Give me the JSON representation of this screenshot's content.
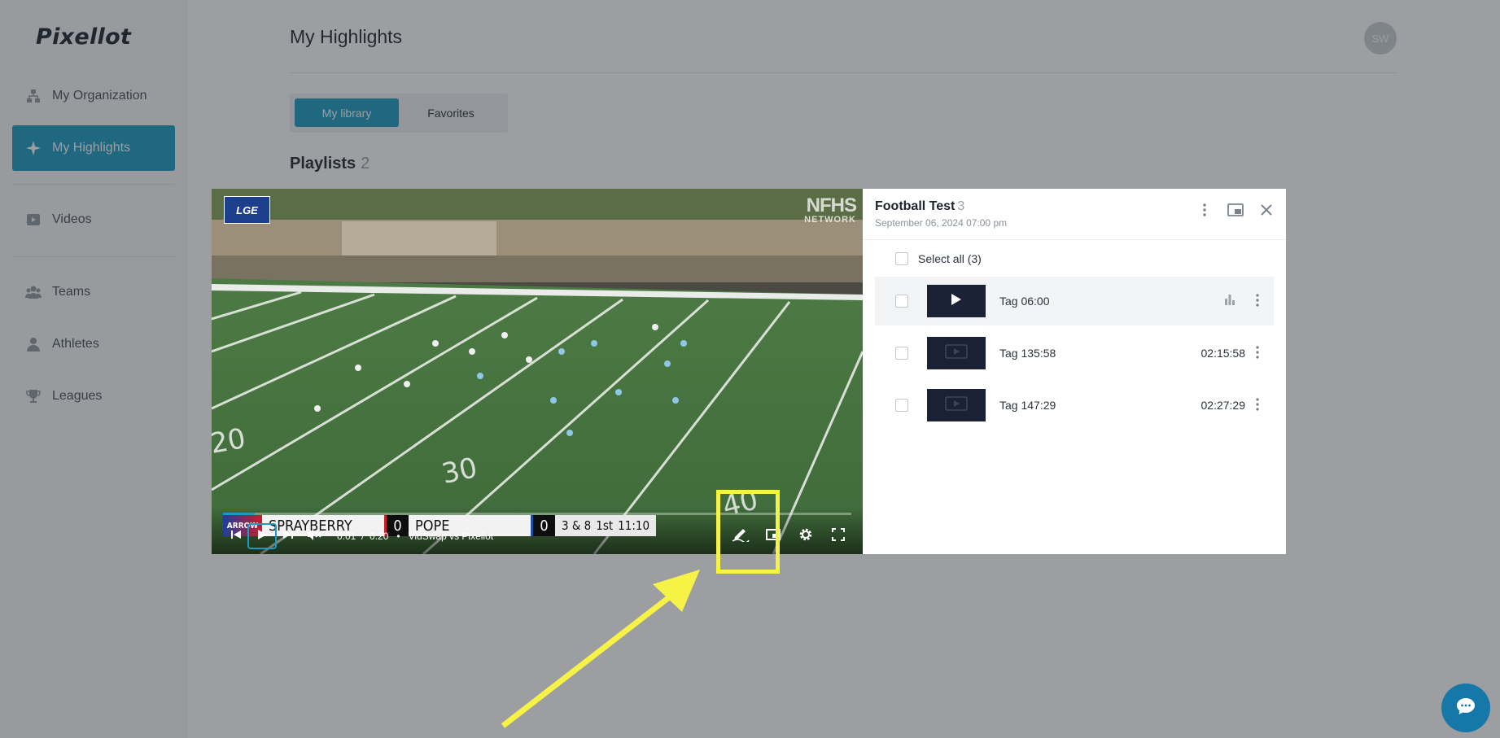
{
  "app": {
    "logo": "Pixellot"
  },
  "sidebar": {
    "items": [
      {
        "label": "My Organization",
        "icon": "org-icon"
      },
      {
        "label": "My Highlights",
        "icon": "sparkle-icon",
        "active": true
      },
      {
        "label": "Videos",
        "icon": "video-icon"
      },
      {
        "label": "Teams",
        "icon": "teams-icon"
      },
      {
        "label": "Athletes",
        "icon": "athlete-icon"
      },
      {
        "label": "Leagues",
        "icon": "trophy-icon"
      }
    ]
  },
  "header": {
    "title": "My Highlights",
    "avatar": "SW"
  },
  "tabs": {
    "library": "My library",
    "favorites": "Favorites"
  },
  "playlists": {
    "label": "Playlists",
    "count": "2"
  },
  "panel": {
    "title": "Football Test",
    "count": "3",
    "date": "September 06, 2024 07:00 pm",
    "select_all": "Select all (3)",
    "clips": [
      {
        "name": "Tag 06:00",
        "time": "",
        "active": true
      },
      {
        "name": "Tag 135:58",
        "time": "02:15:58"
      },
      {
        "name": "Tag 147:29",
        "time": "02:27:29"
      }
    ]
  },
  "player": {
    "watermark_left": "LGE",
    "watermark_nfhs": "NFHS",
    "watermark_network": "NETWORK",
    "current_time": "0:01",
    "separator": "/",
    "duration": "0:20",
    "dot": "•",
    "video_title": "VidSwap vs Pixellot",
    "progress": 0.05,
    "scoreboard": {
      "sponsor": "ARROW",
      "team1": "SPRAYBERRY",
      "score1": "0",
      "team2": "POPE",
      "score2": "0",
      "down": "3 & 8",
      "quarter": "1st",
      "clock": "11:10"
    }
  },
  "colors": {
    "accent": "#1a9bc3",
    "annotation": "#f7f346"
  }
}
